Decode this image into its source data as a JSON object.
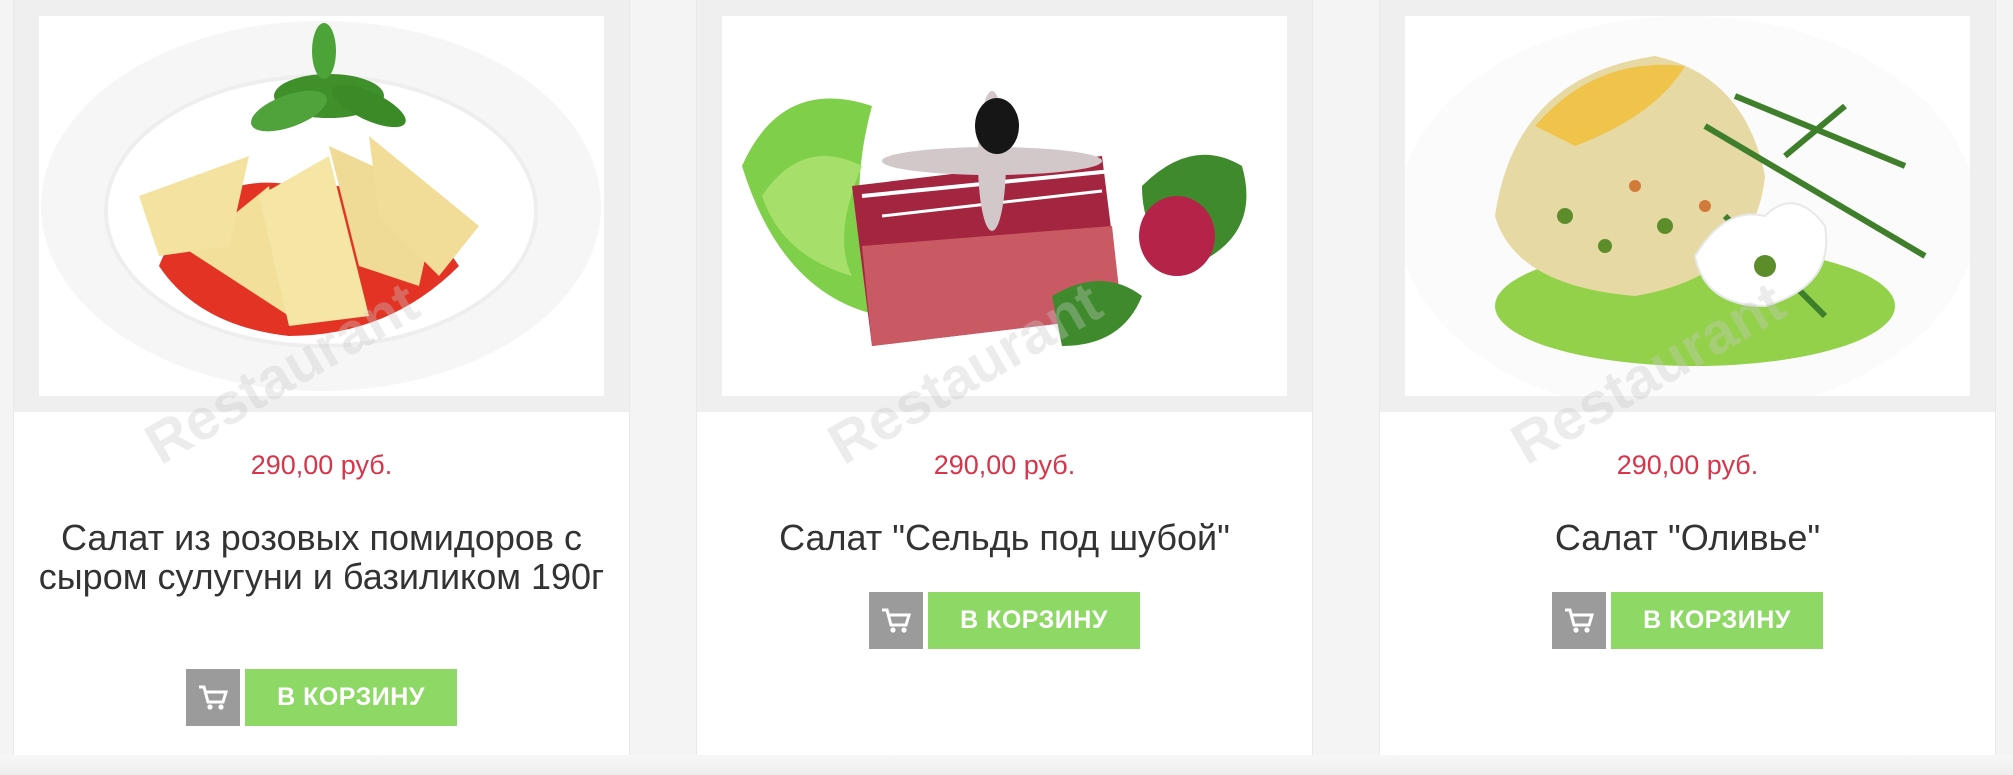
{
  "products": [
    {
      "price": "290,00 руб.",
      "title": "Салат из розовых помидоров с сыром сулугуни и базиликом 190г",
      "cart_label": "В КОРЗИНУ",
      "watermark": "Restaurant"
    },
    {
      "price": "290,00 руб.",
      "title": "Салат \"Сельдь под шубой\"",
      "cart_label": "В КОРЗИНУ",
      "watermark": "Restaurant"
    },
    {
      "price": "290,00 руб.",
      "title": "Салат \"Оливье\"",
      "cart_label": "В КОРЗИНУ",
      "watermark": "Restaurant"
    }
  ],
  "icons": {
    "cart": "shopping-cart-icon"
  },
  "colors": {
    "price": "#d8354a",
    "cart_button": "#8ed966",
    "cart_icon_bg": "#9b9b9b"
  }
}
